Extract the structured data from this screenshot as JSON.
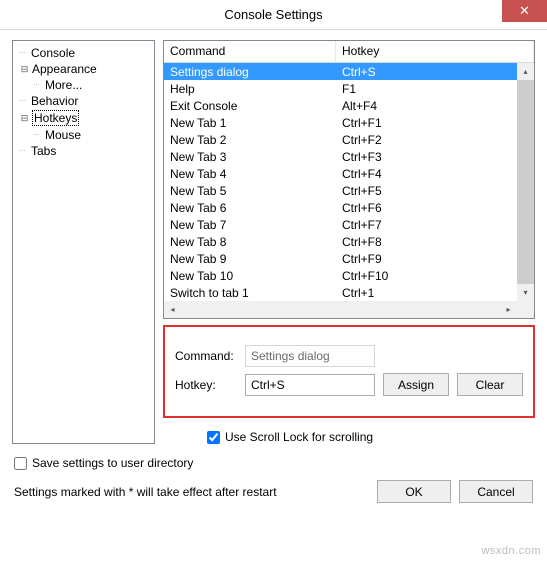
{
  "window": {
    "title": "Console Settings"
  },
  "tree": {
    "items": [
      {
        "label": "Console",
        "indent": 0,
        "expander": ""
      },
      {
        "label": "Appearance",
        "indent": 0,
        "expander": "⊟"
      },
      {
        "label": "More...",
        "indent": 1,
        "expander": ""
      },
      {
        "label": "Behavior",
        "indent": 0,
        "expander": ""
      },
      {
        "label": "Hotkeys",
        "indent": 0,
        "expander": "⊟",
        "selected": true
      },
      {
        "label": "Mouse",
        "indent": 1,
        "expander": ""
      },
      {
        "label": "Tabs",
        "indent": 0,
        "expander": ""
      }
    ]
  },
  "list": {
    "headers": {
      "command": "Command",
      "hotkey": "Hotkey"
    },
    "rows": [
      {
        "cmd": "Settings dialog",
        "hk": "Ctrl+S",
        "selected": true
      },
      {
        "cmd": "Help",
        "hk": "F1"
      },
      {
        "cmd": "Exit Console",
        "hk": "Alt+F4"
      },
      {
        "cmd": "New Tab 1",
        "hk": "Ctrl+F1"
      },
      {
        "cmd": "New Tab 2",
        "hk": "Ctrl+F2"
      },
      {
        "cmd": "New Tab 3",
        "hk": "Ctrl+F3"
      },
      {
        "cmd": "New Tab 4",
        "hk": "Ctrl+F4"
      },
      {
        "cmd": "New Tab 5",
        "hk": "Ctrl+F5"
      },
      {
        "cmd": "New Tab 6",
        "hk": "Ctrl+F6"
      },
      {
        "cmd": "New Tab 7",
        "hk": "Ctrl+F7"
      },
      {
        "cmd": "New Tab 8",
        "hk": "Ctrl+F8"
      },
      {
        "cmd": "New Tab 9",
        "hk": "Ctrl+F9"
      },
      {
        "cmd": "New Tab 10",
        "hk": "Ctrl+F10"
      },
      {
        "cmd": "Switch to tab 1",
        "hk": "Ctrl+1"
      }
    ]
  },
  "edit": {
    "command_label": "Command:",
    "command_value": "Settings dialog",
    "hotkey_label": "Hotkey:",
    "hotkey_value": "Ctrl+S",
    "assign": "Assign",
    "clear": "Clear"
  },
  "scroll_lock_label": "Use Scroll Lock for scrolling",
  "scroll_lock_checked": true,
  "footer": {
    "save_user_dir": "Save settings to user directory",
    "save_user_dir_checked": false,
    "note": "Settings marked with * will take effect after restart",
    "ok": "OK",
    "cancel": "Cancel"
  },
  "watermark": "wsxdn.com"
}
